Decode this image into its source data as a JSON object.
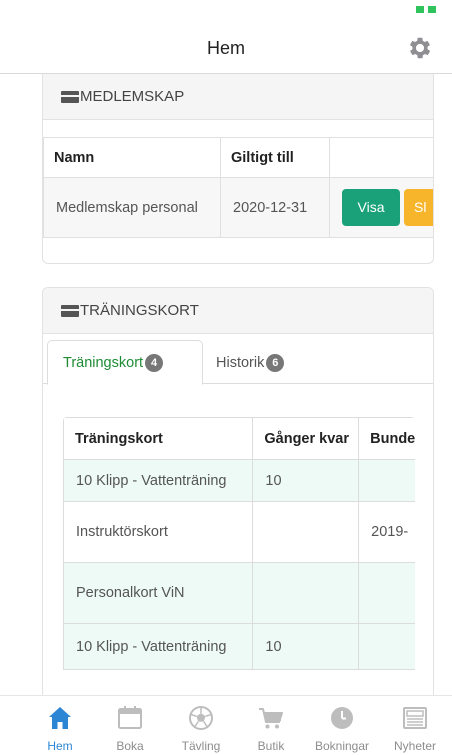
{
  "header": {
    "title": "Hem"
  },
  "membership": {
    "heading": "MEDLEMSKAP",
    "columns": [
      "Namn",
      "Giltigt till",
      ""
    ],
    "rows": [
      {
        "name": "Medlemskap personal",
        "valid_until": "2020-12-31",
        "visa_label": "Visa",
        "second_label": "Sl"
      }
    ]
  },
  "training_cards": {
    "heading": "TRÄNINGSKORT",
    "tabs": [
      {
        "label": "Träningskort",
        "count": "4"
      },
      {
        "label": "Historik",
        "count": "6"
      }
    ],
    "columns": [
      "Träningskort",
      "Gånger kvar",
      "Bunde"
    ],
    "rows": [
      {
        "card": "10 Klipp - Vattenträning",
        "remaining": "10",
        "bound": ""
      },
      {
        "card": "Instruktörskort",
        "remaining": "",
        "bound": "2019-"
      },
      {
        "card": "Personalkort ViN",
        "remaining": "",
        "bound": ""
      },
      {
        "card": "10 Klipp - Vattenträning",
        "remaining": "10",
        "bound": ""
      }
    ]
  },
  "tabbar": {
    "items": [
      {
        "label": "Hem",
        "icon": "home-icon",
        "active": true
      },
      {
        "label": "Boka",
        "icon": "calendar-icon",
        "active": false
      },
      {
        "label": "Tävling",
        "icon": "football-icon",
        "active": false
      },
      {
        "label": "Butik",
        "icon": "cart-icon",
        "active": false
      },
      {
        "label": "Bokningar",
        "icon": "clock-icon",
        "active": false
      },
      {
        "label": "Nyheter",
        "icon": "newspaper-icon",
        "active": false
      }
    ]
  },
  "colors": {
    "accent_blue": "#2d86d4",
    "green_button": "#1aa17a",
    "orange_button": "#f7b52b",
    "active_tab_text": "#1f8c34",
    "battery": "#2ec35d"
  }
}
